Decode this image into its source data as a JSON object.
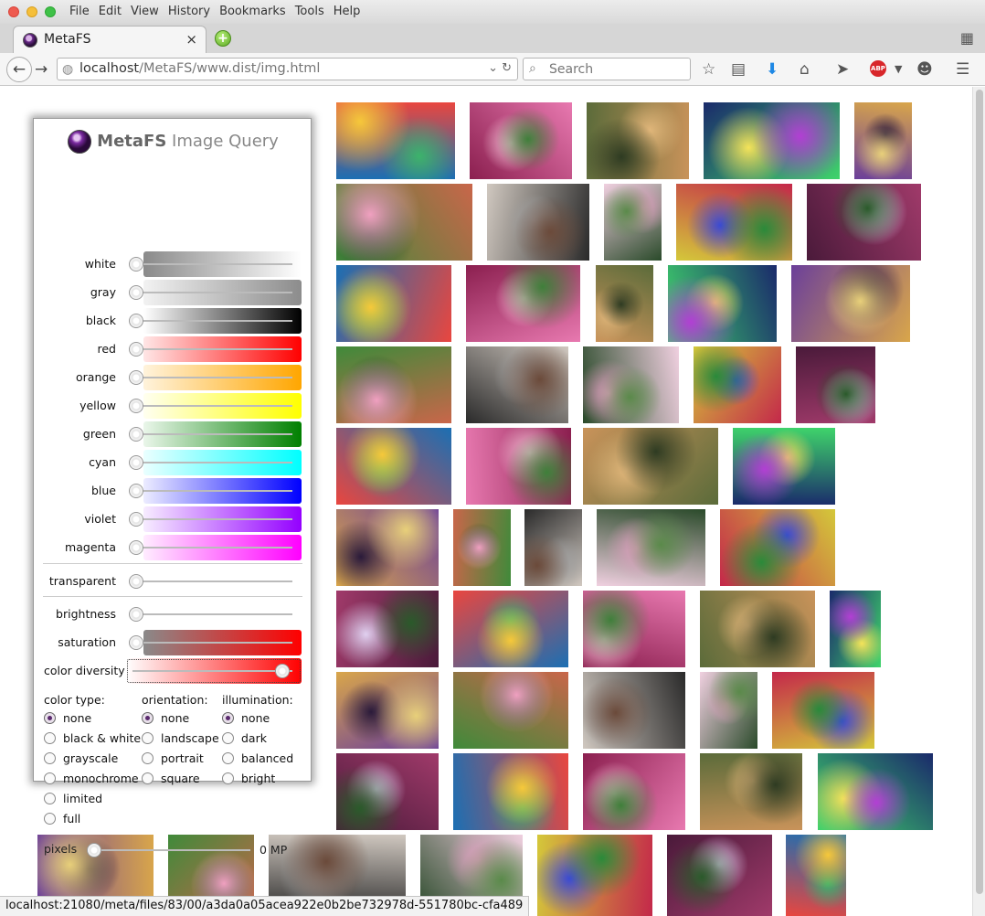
{
  "window": {
    "menu": [
      "File",
      "Edit",
      "View",
      "History",
      "Bookmarks",
      "Tools",
      "Help"
    ]
  },
  "tab": {
    "title": "MetaFS"
  },
  "navbar": {
    "url_host": "localhost",
    "url_path": "/MetaFS/www.dist/img.html",
    "search_placeholder": "Search"
  },
  "panel": {
    "brand": "MetaFS",
    "title": " Image Query",
    "colors": [
      {
        "label": "white",
        "from": "#8a8a8a",
        "to": "#ffffff"
      },
      {
        "label": "gray",
        "from": "#f2f2f2",
        "to": "#8c8c8c"
      },
      {
        "label": "black",
        "from": "#ffffff",
        "to": "#000000"
      },
      {
        "label": "red",
        "from": "#ffe6e6",
        "to": "#ff0000"
      },
      {
        "label": "orange",
        "from": "#fff3dc",
        "to": "#ffa600"
      },
      {
        "label": "yellow",
        "from": "#fffff0",
        "to": "#ffff00"
      },
      {
        "label": "green",
        "from": "#eaf6ea",
        "to": "#008000"
      },
      {
        "label": "cyan",
        "from": "#eaffff",
        "to": "#00ffff"
      },
      {
        "label": "blue",
        "from": "#ececff",
        "to": "#0000ff"
      },
      {
        "label": "violet",
        "from": "#f7ecff",
        "to": "#9400ff"
      },
      {
        "label": "magenta",
        "from": "#ffecff",
        "to": "#ff00ff"
      }
    ],
    "transparent": "transparent",
    "brightness": "brightness",
    "saturation": "saturation",
    "saturation_from": "#8a8a8a",
    "saturation_to": "#ff0000",
    "color_diversity": "color diversity",
    "color_diversity_from": "#ffffff",
    "color_diversity_to": "#ff0000",
    "color_type_header": "color type:",
    "color_types": [
      "none",
      "black & white",
      "grayscale",
      "monochrome",
      "limited",
      "full"
    ],
    "orientation_header": "orientation:",
    "orientations": [
      "none",
      "landscape",
      "portrait",
      "square"
    ],
    "illumination_header": "illumination:",
    "illuminations": [
      "none",
      "dark",
      "balanced",
      "bright"
    ],
    "pixels_label": "pixels",
    "pixels_value": "0 MP"
  },
  "status_url": "localhost:21080/meta/files/83/00/a3da0a05acea922e0b2be732978d-551780bc-cfa489"
}
